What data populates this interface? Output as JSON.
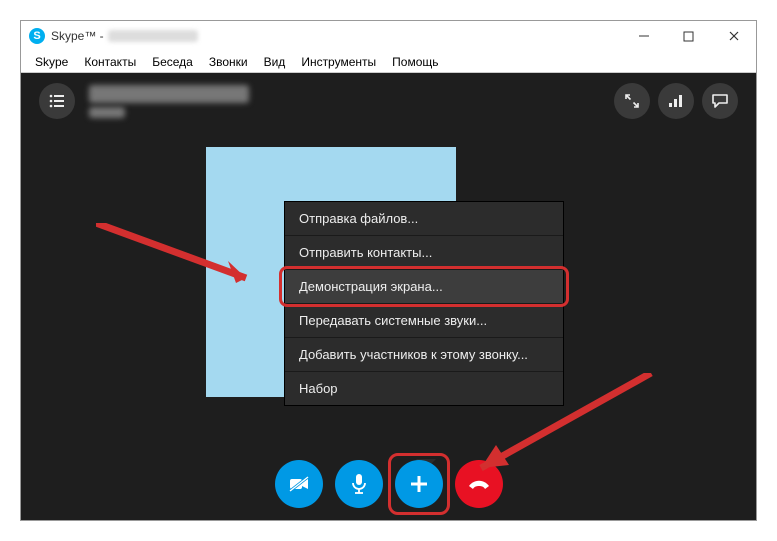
{
  "window": {
    "title": "Skype™ -",
    "controls": {
      "min": "—",
      "max": "☐",
      "close": "✕"
    }
  },
  "menubar": {
    "items": [
      "Skype",
      "Контакты",
      "Беседа",
      "Звонки",
      "Вид",
      "Инструменты",
      "Помощь"
    ]
  },
  "call": {
    "listBtn": "≣",
    "fullscreenBtn": "⤢",
    "signalBtn": "▮",
    "chatBtn": "💬"
  },
  "popup": {
    "items": [
      {
        "label": "Отправка файлов..."
      },
      {
        "label": "Отправить контакты..."
      },
      {
        "label": "Демонстрация экрана...",
        "highlighted": true,
        "hovered": true
      },
      {
        "label": "Передавать системные звуки..."
      },
      {
        "label": "Добавить участников к этому звонку..."
      },
      {
        "label": "Набор"
      }
    ]
  },
  "controls": {
    "camera": "⟋",
    "mic": "🎤",
    "plus": "+",
    "hang": "⌒"
  }
}
